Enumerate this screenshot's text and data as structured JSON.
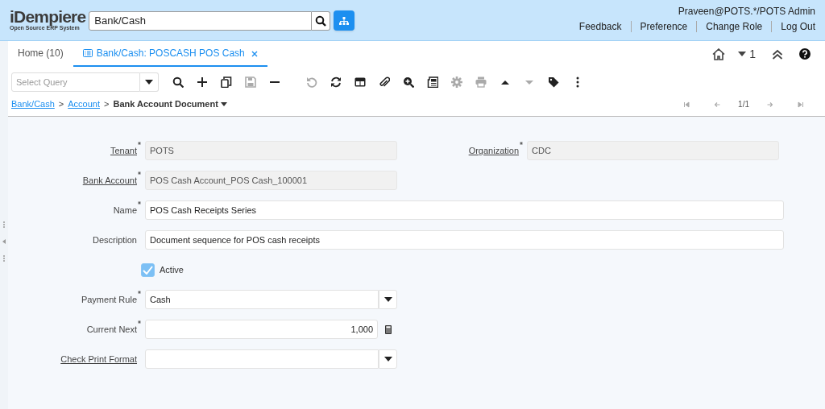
{
  "header": {
    "logo": {
      "name": "iDempiere",
      "tagline": "Open Source ERP System"
    },
    "search": {
      "value": "Bank/Cash"
    },
    "user": "Praveen@POTS.*/POTS Admin",
    "links": [
      "Feedback",
      "Preference",
      "Change Role",
      "Log Out"
    ]
  },
  "tabs": [
    {
      "kind": "home",
      "label": "Home (10)",
      "selected": false
    },
    {
      "kind": "window",
      "label": "Bank/Cash: POSCASH POS Cash",
      "selected": true
    }
  ],
  "tab_tools": {
    "count": "1"
  },
  "toolbar": {
    "query": {
      "placeholder": "Select Query"
    },
    "buttons": [
      {
        "kind": "find",
        "disabled": false
      },
      {
        "kind": "new",
        "disabled": false
      },
      {
        "kind": "copy",
        "disabled": false
      },
      {
        "kind": "save",
        "disabled": true
      },
      {
        "kind": "delete",
        "disabled": false
      },
      {
        "kind": "undo",
        "disabled": true
      },
      {
        "kind": "refresh",
        "disabled": false
      },
      {
        "kind": "grid",
        "disabled": false
      },
      {
        "kind": "attach",
        "disabled": false
      },
      {
        "kind": "zoom",
        "disabled": false
      },
      {
        "kind": "report",
        "disabled": false
      },
      {
        "kind": "settings",
        "disabled": true
      },
      {
        "kind": "print",
        "disabled": true
      },
      {
        "kind": "up",
        "disabled": false
      },
      {
        "kind": "down",
        "disabled": true
      },
      {
        "kind": "tag",
        "disabled": false
      },
      {
        "kind": "more",
        "disabled": false
      }
    ]
  },
  "breadcrumb": [
    {
      "kind": "link",
      "label": "Bank/Cash"
    },
    {
      "kind": "separator",
      "label": ">"
    },
    {
      "kind": "link",
      "label": "Account"
    },
    {
      "kind": "separator",
      "label": ">"
    },
    {
      "kind": "current",
      "label": "Bank Account Document"
    }
  ],
  "navigation": {
    "record": "1/1",
    "buttons": [
      {
        "kind": "first",
        "disabled": true
      },
      {
        "kind": "prev",
        "disabled": true
      },
      {
        "kind": "next",
        "disabled": true
      },
      {
        "kind": "last",
        "disabled": true
      }
    ]
  },
  "form": {
    "rows": [
      {
        "fields": [
          {
            "kind": "readonly",
            "label": "Tenant",
            "link": true,
            "required": true,
            "value": "POTS"
          },
          {
            "kind": "readonly",
            "label": "Organization",
            "link": true,
            "required": true,
            "value": "CDC"
          }
        ]
      },
      {
        "fields": [
          {
            "kind": "readonly",
            "label": "Bank Account",
            "link": true,
            "required": true,
            "value": "POS Cash Account_POS Cash_100001"
          }
        ]
      },
      {
        "fields": [
          {
            "kind": "text",
            "label": "Name",
            "link": false,
            "required": true,
            "value": "POS Cash Receipts Series"
          }
        ]
      },
      {
        "fields": [
          {
            "kind": "text",
            "label": "Description",
            "link": false,
            "required": false,
            "value": "Document sequence for POS cash receipts"
          }
        ]
      },
      {
        "fields": [
          {
            "kind": "checkbox",
            "label": "Active",
            "checked": true
          }
        ]
      },
      {
        "fields": [
          {
            "kind": "select",
            "label": "Payment Rule",
            "link": false,
            "required": true,
            "value": "Cash"
          }
        ]
      },
      {
        "fields": [
          {
            "kind": "number",
            "label": "Current Next",
            "link": false,
            "required": true,
            "value": "1,000"
          }
        ]
      },
      {
        "fields": [
          {
            "kind": "select",
            "label": "Check Print Format",
            "link": true,
            "required": false
          }
        ]
      }
    ]
  }
}
